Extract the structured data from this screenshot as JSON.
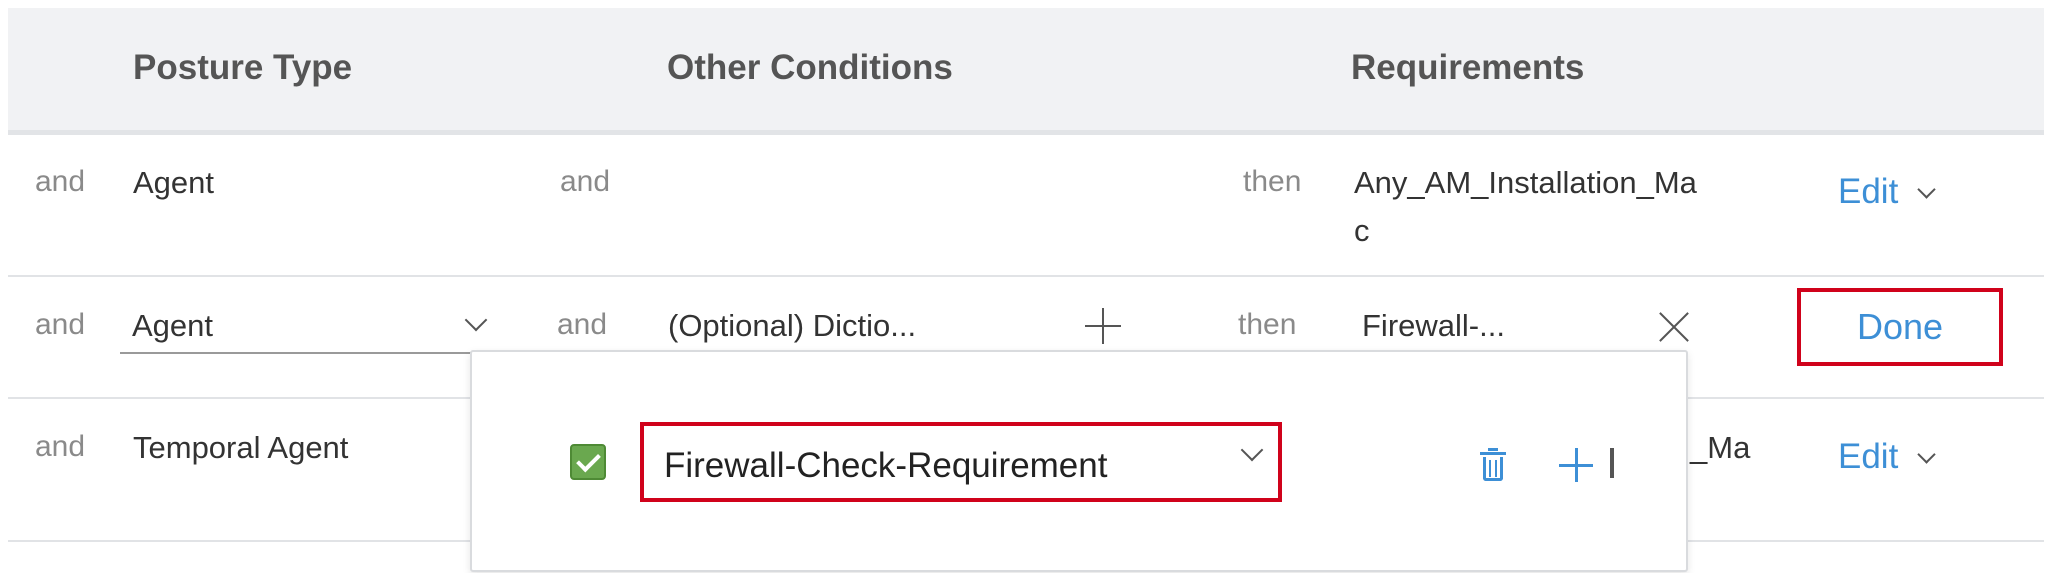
{
  "header": {
    "posture_type": "Posture Type",
    "other_conditions": "Other Conditions",
    "requirements": "Requirements"
  },
  "rows": [
    {
      "connector1": "and",
      "posture": "Agent",
      "connector2": "and",
      "connector3": "then",
      "requirement_line1": "Any_AM_Installation_Ma",
      "requirement_line2": "c",
      "action": "Edit"
    },
    {
      "connector1": "and",
      "posture": "Agent",
      "connector2": "and",
      "conditions_placeholder": "(Optional) Dictio...",
      "connector3": "then",
      "requirement": "Firewall-...",
      "action": "Done"
    },
    {
      "connector1": "and",
      "posture": "Temporal Agent",
      "requirement_partial": "_Ma",
      "action": "Edit"
    }
  ],
  "popup": {
    "selected_requirement": "Firewall-Check-Requirement",
    "checked": true
  },
  "colors": {
    "link": "#3d8fd6",
    "highlight": "#d0021b",
    "checkbox": "#6aa84f"
  }
}
